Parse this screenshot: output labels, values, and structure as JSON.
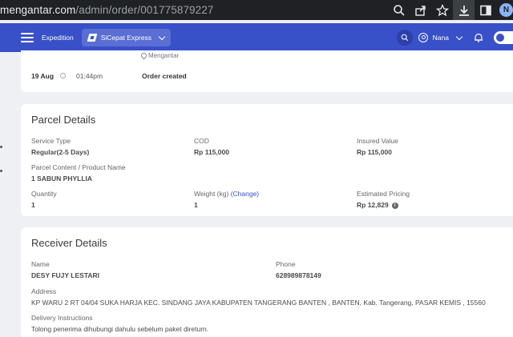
{
  "browser": {
    "url_host": "mengantar.com",
    "url_path": "/admin/order/001775879227",
    "profile_initial": "N"
  },
  "header": {
    "expedition_label": "Expedition",
    "courier": "SiCepat Express",
    "user_name": "Nana"
  },
  "timeline": {
    "location": "Mengantar",
    "date": "19 Aug",
    "time": "01:44pm",
    "status": "Order created"
  },
  "parcel": {
    "title": "Parcel Details",
    "service_type_label": "Service Type",
    "service_type": "Regular(2-5 Days)",
    "cod_label": "COD",
    "cod": "Rp 115,000",
    "insured_label": "Insured Value",
    "insured": "Rp 115,000",
    "content_label": "Parcel Content / Product Name",
    "content": "1 SABUN PHYLLIA",
    "quantity_label": "Quantity",
    "quantity": "1",
    "weight_label": "Weight (kg)",
    "weight_change": "(Change)",
    "weight": "1",
    "pricing_label": "Estimated Pricing",
    "pricing": "Rp 12,829"
  },
  "receiver": {
    "title": "Receiver Details",
    "name_label": "Name",
    "name": "DESY FUJY LESTARI",
    "phone_label": "Phone",
    "phone": "628989878149",
    "address_label": "Address",
    "address": "KP WARU 2 RT 04/04 SUKA HARJA KEC. SINDANG JAYA KABUPATEN TANGERANG BANTEN , BANTEN, Kab. Tangerang, PASAR KEMIS , 15560",
    "instructions_label": "Delivery Instructions",
    "instructions": "Tolong penerima dihubungi dahulu sebelum paket direturn."
  },
  "colors": {
    "header_bg": "#3850c8",
    "link": "#3850c8",
    "browser_bar": "#202124"
  },
  "icons": [
    "search-icon",
    "share-icon",
    "star-icon",
    "download-icon",
    "sidebar-icon",
    "menu-icon",
    "courier-logo-icon",
    "chevron-down-icon",
    "user-icon",
    "bell-icon",
    "location-pin-icon",
    "clock-icon",
    "info-icon"
  ]
}
